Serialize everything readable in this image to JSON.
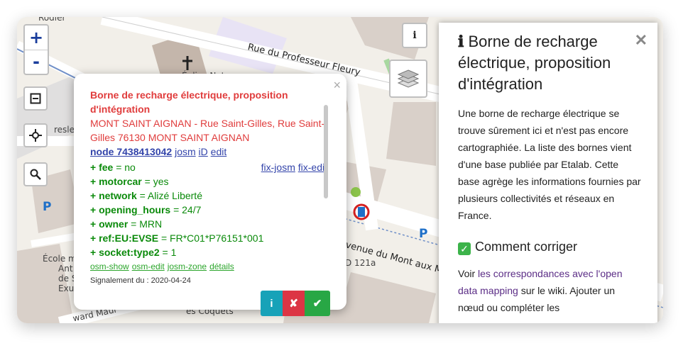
{
  "map": {
    "street_1": "Rue du Professeur Fleury",
    "street_2": "Avenue du Mont aux Malades",
    "road_ref": "D 121a",
    "church_label": "Église Notre",
    "school_label_1": "École m",
    "school_label_2": "Ant",
    "school_label_3": "de S",
    "school_label_4": "Exu",
    "street_partial_1": "resle",
    "street_partial_2": "ward Maur",
    "street_partial_3": "es Coquets",
    "parking": "P",
    "top_label": "Rodier"
  },
  "controls": {
    "zoom_in": "+",
    "zoom_out": "-",
    "info": "i"
  },
  "popup": {
    "title": "Borne de recharge électrique, proposition d'intégration",
    "address": "MONT SAINT AIGNAN - Rue Saint-Gilles, Rue Saint-Gilles 76130 MONT SAINT AIGNAN",
    "node_link": "node 7438413042",
    "josm_link": "josm",
    "id_link": "iD",
    "edit_link": "edit",
    "fix_josm": "fix-josm",
    "fix_edit": "fix-edit",
    "tags": [
      {
        "key": "+ fee",
        "value": " = no"
      },
      {
        "key": "+ motorcar",
        "value": " = yes"
      },
      {
        "key": "+ network",
        "value": " = Alizé Liberté"
      },
      {
        "key": "+ opening_hours",
        "value": " = 24/7"
      },
      {
        "key": "+ owner",
        "value": " = MRN"
      },
      {
        "key": "+ ref:EU:EVSE",
        "value": " = FR*C01*P76151*001"
      },
      {
        "key": "+ socket:type2",
        "value": " = 1"
      }
    ],
    "osm_show": "osm-show",
    "osm_edit": "osm-edit",
    "josm_zone": "josm-zone",
    "details": "détails",
    "report": "Signalement du : 2020-04-24",
    "btn_info": "i",
    "btn_reject": "✘",
    "btn_accept": "✔"
  },
  "panel": {
    "title_icon": "ℹ",
    "title": "Borne de recharge électrique, proposition d'intégration",
    "close": "✕",
    "desc": "Une borne de recharge électrique se trouve sûrement ici et n'est pas encore cartographiée. La liste des bornes vient d'une base publiée par Etalab. Cette base agrège les informations fournies par plusieurs collectivités et réseaux en France.",
    "how_fix_title": "Comment corriger",
    "fix_text_1": "Voir ",
    "fix_link": "les correspondances avec l'open data mapping",
    "fix_text_2": " sur le wiki. Ajouter un nœud ou compléter les"
  }
}
